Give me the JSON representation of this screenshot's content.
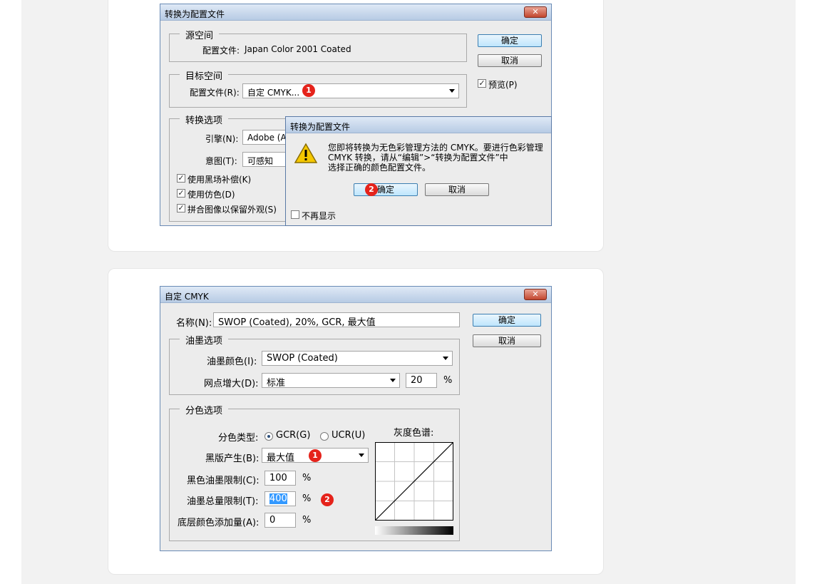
{
  "d1": {
    "title": "转换为配置文件",
    "close": "✕",
    "ok": "确定",
    "cancel": "取消",
    "preview": "预览(P)",
    "source": {
      "legend": "源空间",
      "profile_label": "配置文件:",
      "profile_value": "Japan Color 2001 Coated"
    },
    "dest": {
      "legend": "目标空间",
      "profile_label": "配置文件(R):",
      "profile_value": "自定 CMYK..."
    },
    "conv": {
      "legend": "转换选项",
      "engine_label": "引擎(N):",
      "engine_value": "Adobe (A",
      "intent_label": "意图(T):",
      "intent_value": "可感知",
      "bpc": "使用黑场补偿(K)",
      "dither": "使用仿色(D)",
      "flatten": "拼合图像以保留外观(S)"
    },
    "badge1": "1"
  },
  "alert": {
    "title": "转换为配置文件",
    "line1": "您即将转换为无色彩管理方法的 CMYK。要进行色彩管理",
    "line2": "CMYK 转换，请从“编辑”>“转换为配置文件”中",
    "line3": "选择正确的颜色配置文件。",
    "ok": "确定",
    "cancel": "取消",
    "dont_show": "不再显示",
    "badge": "2"
  },
  "d2": {
    "title": "自定 CMYK",
    "close": "✕",
    "ok": "确定",
    "cancel": "取消",
    "name_label": "名称(N):",
    "name_value": "SWOP (Coated), 20%, GCR, 最大值",
    "ink": {
      "legend": "油墨选项",
      "colors_label": "油墨颜色(I):",
      "colors_value": "SWOP (Coated)",
      "dot_label": "网点增大(D):",
      "dot_value": "标准",
      "dot_pct": "20",
      "pct": "%"
    },
    "sep": {
      "legend": "分色选项",
      "type_label": "分色类型:",
      "gcr": "GCR(G)",
      "ucr": "UCR(U)",
      "black_label": "黑版产生(B):",
      "black_value": "最大值",
      "bik_label": "黑色油墨限制(C):",
      "bik_value": "100",
      "tik_label": "油墨总量限制(T):",
      "tik_value": "400",
      "ucaa_label": "底层颜色添加量(A):",
      "ucaa_value": "0",
      "pct": "%",
      "gray_label": "灰度色谱:"
    },
    "badge1": "1",
    "badge2": "2"
  }
}
